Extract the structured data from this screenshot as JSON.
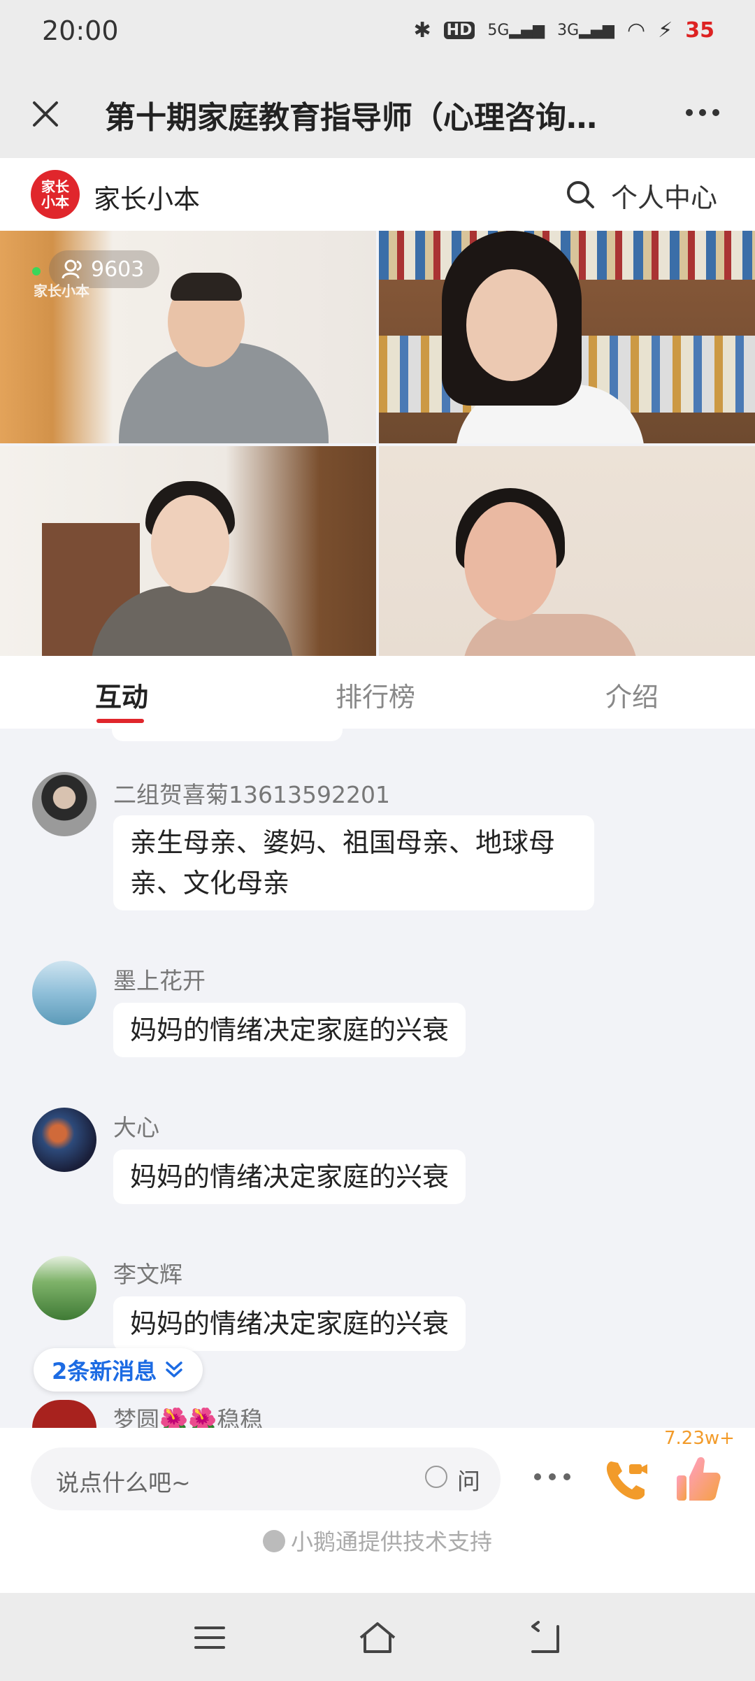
{
  "status_bar": {
    "time": "20:00",
    "icons": [
      "bluetooth-icon",
      "hd-icon",
      "5g-signal-icon",
      "3g-signal-icon",
      "wifi-icon",
      "charging-icon"
    ],
    "battery": "35"
  },
  "header": {
    "title": "第十期家庭教育指导师（心理咨询…"
  },
  "brand": {
    "logo_text": "家长小本",
    "name": "家长小本",
    "user_center": "个人中心"
  },
  "live": {
    "viewer_count": "9603",
    "watermark": "家长小本"
  },
  "tabs": [
    {
      "label": "互动",
      "active": true
    },
    {
      "label": "排行榜",
      "active": false
    },
    {
      "label": "介绍",
      "active": false
    }
  ],
  "messages": [
    {
      "name": "二组贺喜菊13613592201",
      "text_line1": "亲生母亲、婆妈、祖国母亲、地球母",
      "text_line2": "亲、文化母亲",
      "avatar": "avatar-woman-black-suit"
    },
    {
      "name": "墨上花开",
      "text": "妈妈的情绪决定家庭的兴衰",
      "avatar": "avatar-beach-sea"
    },
    {
      "name": "大心",
      "text": "妈妈的情绪决定家庭的兴衰",
      "avatar": "avatar-galaxy"
    },
    {
      "name": "李文辉",
      "text": "妈妈的情绪决定家庭的兴衰",
      "avatar": "avatar-green-trees"
    },
    {
      "name": "梦圆🌺🌺稳稳",
      "avatar": "avatar-red"
    }
  ],
  "new_messages": "2条新消息",
  "bottom": {
    "input_placeholder": "说点什么吧~",
    "ask_label": "问",
    "like_count": "7.23w+",
    "powered_by": "小鹅通提供技术支持"
  },
  "colors": {
    "accent_red": "#e0262c",
    "link_blue": "#1c6be3",
    "like_orange": "#f29b2a"
  }
}
